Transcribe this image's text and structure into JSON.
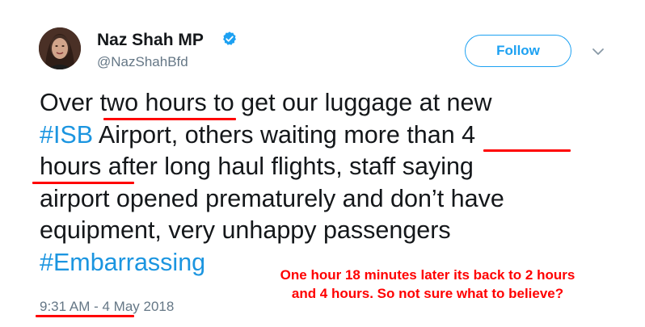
{
  "tweet": {
    "author_name": "Naz Shah MP",
    "handle": "@NazShahBfd",
    "follow_label": "Follow",
    "body_lines": [
      {
        "parts": [
          {
            "text": "Over two hours to get our luggage at new",
            "type": "text"
          }
        ]
      },
      {
        "parts": [
          {
            "text": "#ISB",
            "type": "hashtag"
          },
          {
            "text": " Airport, others waiting more than 4",
            "type": "text"
          }
        ]
      },
      {
        "parts": [
          {
            "text": "hours after long haul flights, staff saying",
            "type": "text"
          }
        ]
      },
      {
        "parts": [
          {
            "text": "airport opened prematurely and don’t have",
            "type": "text"
          }
        ]
      },
      {
        "parts": [
          {
            "text": "equipment, very unhappy passengers",
            "type": "text"
          }
        ]
      },
      {
        "parts": [
          {
            "text": "#Embarrassing",
            "type": "hashtag"
          }
        ]
      }
    ],
    "timestamp": "9:31 AM - 4 May 2018"
  },
  "annotation": {
    "lines": [
      "One hour 18 minutes later its back to 2 hours",
      "and 4 hours. So not sure what to believe?"
    ]
  },
  "colors": {
    "accent": "#1da1f2",
    "hashtag": "#1b95e0",
    "text": "#14171a",
    "muted": "#657786",
    "annotation": "#ff0000"
  },
  "icons": {
    "verified": "verified-badge-icon",
    "more": "chevron-down-icon"
  }
}
